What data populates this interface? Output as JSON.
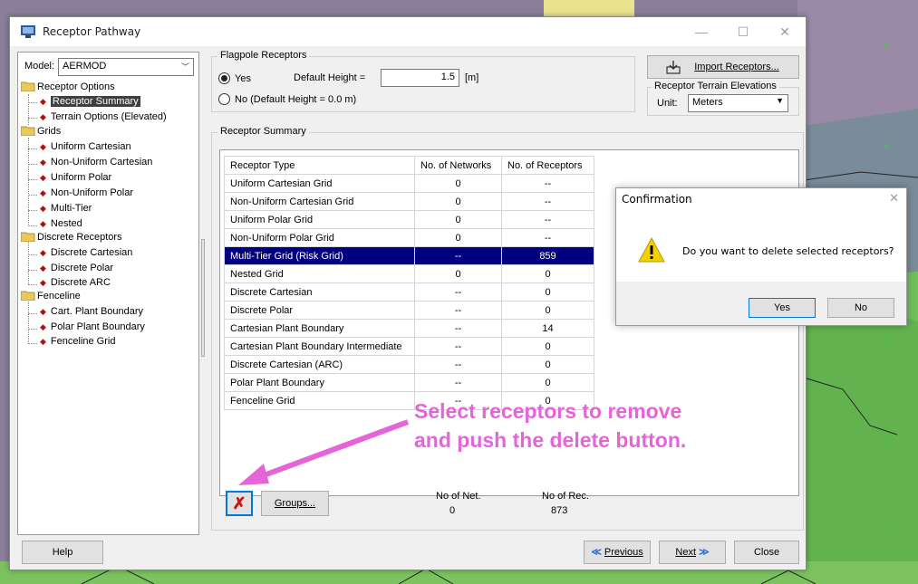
{
  "window": {
    "title": "Receptor Pathway"
  },
  "model": {
    "label": "Model:",
    "value": "AERMOD"
  },
  "tree": {
    "receptor_options": "Receptor Options",
    "receptor_summary": "Receptor Summary",
    "terrain_options": "Terrain Options (Elevated)",
    "grids": "Grids",
    "uniform_cartesian": "Uniform Cartesian",
    "non_uniform_cartesian": "Non-Uniform Cartesian",
    "uniform_polar": "Uniform Polar",
    "non_uniform_polar": "Non-Uniform Polar",
    "multi_tier": "Multi-Tier",
    "nested": "Nested",
    "discrete_receptors": "Discrete Receptors",
    "discrete_cartesian": "Discrete Cartesian",
    "discrete_polar": "Discrete Polar",
    "discrete_arc": "Discrete ARC",
    "fenceline": "Fenceline",
    "cart_plant_boundary": "Cart. Plant Boundary",
    "polar_plant_boundary": "Polar Plant Boundary",
    "fenceline_grid": "Fenceline Grid"
  },
  "flagpole": {
    "group_label": "Flagpole Receptors",
    "yes_label": "Yes",
    "default_height_label": "Default Height =",
    "default_height_value": "1.5",
    "unit": "[m]",
    "no_label": "No (Default Height = 0.0 m)"
  },
  "import_button": "Import Receptors...",
  "terrain": {
    "group_label": "Receptor Terrain Elevations",
    "unit_label": "Unit:",
    "unit_value": "Meters"
  },
  "summary": {
    "group_label": "Receptor Summary",
    "columns": [
      "Receptor Type",
      "No. of Networks",
      "No. of Receptors"
    ],
    "rows": [
      [
        "Uniform Cartesian Grid",
        "0",
        "--"
      ],
      [
        "Non-Uniform Cartesian Grid",
        "0",
        "--"
      ],
      [
        "Uniform Polar Grid",
        "0",
        "--"
      ],
      [
        "Non-Uniform Polar Grid",
        "0",
        "--"
      ],
      [
        "Multi-Tier Grid (Risk Grid)",
        "--",
        "859"
      ],
      [
        "Nested Grid",
        "0",
        "0"
      ],
      [
        "Discrete Cartesian",
        "--",
        "0"
      ],
      [
        "Discrete Polar",
        "--",
        "0"
      ],
      [
        "Cartesian Plant Boundary",
        "--",
        "14"
      ],
      [
        "Cartesian Plant Boundary Intermediate",
        "--",
        "0"
      ],
      [
        "Discrete Cartesian (ARC)",
        "--",
        "0"
      ],
      [
        "Polar Plant Boundary",
        "--",
        "0"
      ],
      [
        "Fenceline Grid",
        "--",
        "0"
      ]
    ],
    "selected_row": 4
  },
  "footer_counts": {
    "net_label": "No of Net.",
    "net_value": "0",
    "rec_label": "No of Rec.",
    "rec_value": "873"
  },
  "buttons": {
    "groups": "Groups...",
    "help": "Help",
    "previous": "Previous",
    "next": "Next",
    "close": "Close"
  },
  "dialog": {
    "title": "Confirmation",
    "message": "Do you want to delete selected receptors?",
    "yes": "Yes",
    "no": "No"
  },
  "annotation": {
    "line1": "Select receptors to remove",
    "line2": "and push the delete button."
  },
  "colors": {
    "selection": "#000080",
    "annotation": "#e565d8",
    "delete_icon": "#d01010"
  }
}
